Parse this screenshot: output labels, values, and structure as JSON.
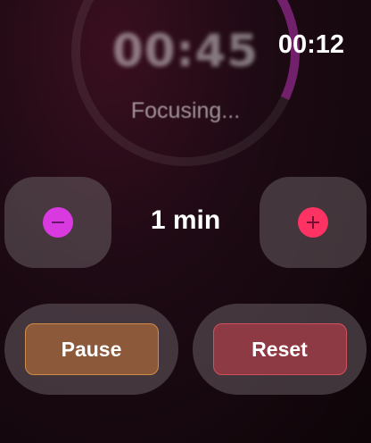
{
  "background_timer": "00:45",
  "clock": "00:12",
  "status": "Focusing...",
  "stepper": {
    "decrement_icon": "minus-circle-icon",
    "increment_icon": "plus-circle-icon",
    "decrement_color": "#d83ae0",
    "increment_color": "#ff3264",
    "value": "1 min"
  },
  "actions": {
    "pause_label": "Pause",
    "reset_label": "Reset",
    "pause_color": "#8c5a3a",
    "reset_color": "#8d3a44"
  }
}
